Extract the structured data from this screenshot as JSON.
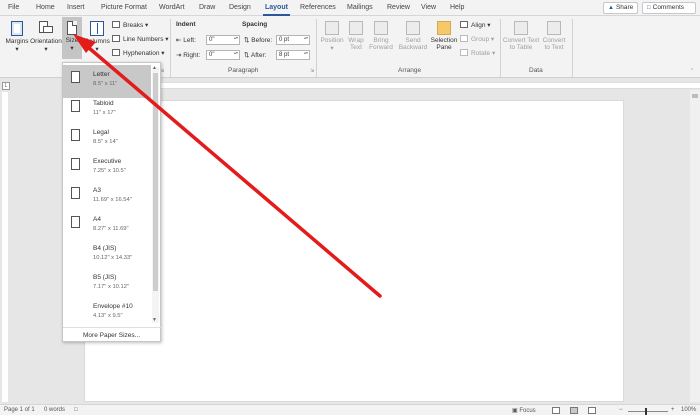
{
  "tabs": [
    "File",
    "Home",
    "Insert",
    "Picture Format",
    "WordArt",
    "Draw",
    "Design",
    "Layout",
    "References",
    "Mailings",
    "Review",
    "View",
    "Help"
  ],
  "active_tab": "Layout",
  "share_label": "Share",
  "comments_label": "Comments",
  "page_setup": {
    "margins": "Margins",
    "orientation": "Orientation",
    "size": "Size",
    "columns": "Columns",
    "breaks": "Breaks",
    "line_numbers": "Line Numbers",
    "hyphenation": "Hyphenation"
  },
  "paragraph": {
    "indent_heading": "Indent",
    "spacing_heading": "Spacing",
    "left_label": "Left:",
    "left_value": "0\"",
    "right_label": "Right:",
    "right_value": "0\"",
    "before_label": "Before:",
    "before_value": "0 pt",
    "after_label": "After:",
    "after_value": "8 pt",
    "group_label": "Paragraph"
  },
  "arrange": {
    "position": "Position",
    "wrap_text_1": "Wrap",
    "wrap_text_2": "Text",
    "bring_forward_1": "Bring",
    "bring_forward_2": "Forward",
    "send_backward_1": "Send",
    "send_backward_2": "Backward",
    "selection_pane_1": "Selection",
    "selection_pane_2": "Pane",
    "align": "Align",
    "group": "Group",
    "rotate": "Rotate",
    "group_label": "Arrange"
  },
  "data_group": {
    "convert_to_table_1": "Convert Text",
    "convert_to_table_2": "to Table",
    "convert_to_text_1": "Convert",
    "convert_to_text_2": "to Text",
    "group_label": "Data"
  },
  "size_menu": {
    "items": [
      {
        "name": "Letter",
        "dims": "8.5\" x 11\"",
        "selected": true
      },
      {
        "name": "Tabloid",
        "dims": "11\" x 17\""
      },
      {
        "name": "Legal",
        "dims": "8.5\" x 14\""
      },
      {
        "name": "Executive",
        "dims": "7.25\" x 10.5\""
      },
      {
        "name": "A3",
        "dims": "11.69\" x 16.54\""
      },
      {
        "name": "A4",
        "dims": "8.27\" x 11.69\""
      },
      {
        "name": "B4 (JIS)",
        "dims": "10.12\" x 14.33\""
      },
      {
        "name": "B5 (JIS)",
        "dims": "7.17\" x 10.12\""
      },
      {
        "name": "Envelope #10",
        "dims": "4.13\" x 9.5\""
      }
    ],
    "more": "More Paper Sizes..."
  },
  "status": {
    "page": "Page 1 of 1",
    "words": "0 words",
    "focus": "Focus",
    "zoom": "100%"
  },
  "colors": {
    "accent": "#2b579a",
    "annotation_arrow": "#e31b1b"
  },
  "icons": [
    "margins-icon",
    "orientation-icon",
    "size-icon",
    "columns-icon",
    "breaks-icon",
    "line-numbers-icon",
    "hyphenation-icon",
    "selection-pane-icon",
    "focus-icon"
  ]
}
